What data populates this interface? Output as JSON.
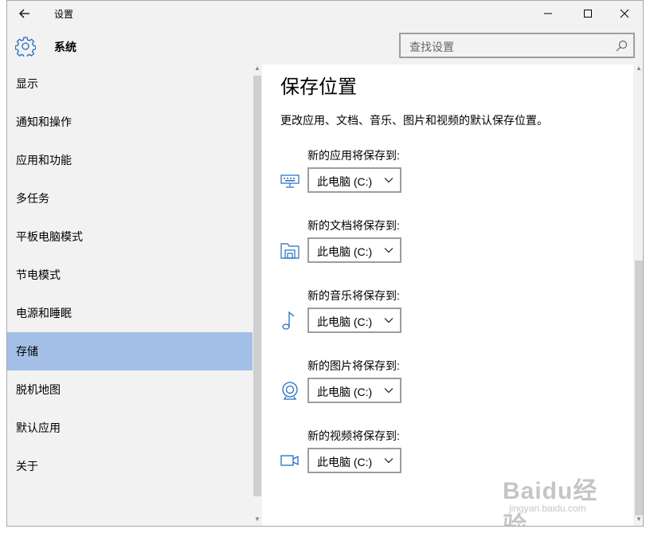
{
  "window": {
    "title": "设置",
    "section_title": "系统",
    "controls": {
      "minimize": "minimize-icon",
      "maximize": "maximize-icon",
      "close": "close-icon"
    }
  },
  "search": {
    "placeholder": "查找设置"
  },
  "sidebar": {
    "items": [
      {
        "label": "显示"
      },
      {
        "label": "通知和操作"
      },
      {
        "label": "应用和功能"
      },
      {
        "label": "多任务"
      },
      {
        "label": "平板电脑模式"
      },
      {
        "label": "节电模式"
      },
      {
        "label": "电源和睡眠"
      },
      {
        "label": "存储",
        "active": true
      },
      {
        "label": "脱机地图"
      },
      {
        "label": "默认应用"
      },
      {
        "label": "关于"
      }
    ]
  },
  "main": {
    "title": "保存位置",
    "description": "更改应用、文档、音乐、图片和视频的默认保存位置。",
    "groups": [
      {
        "label": "新的应用将保存到:",
        "value": "此电脑 (C:)",
        "icon": "monitor-icon"
      },
      {
        "label": "新的文档将保存到:",
        "value": "此电脑 (C:)",
        "icon": "folder-icon"
      },
      {
        "label": "新的音乐将保存到:",
        "value": "此电脑 (C:)",
        "icon": "music-note-icon"
      },
      {
        "label": "新的图片将保存到:",
        "value": "此电脑 (C:)",
        "icon": "camera-icon"
      },
      {
        "label": "新的视频将保存到:",
        "value": "此电脑 (C:)",
        "icon": "video-camera-icon"
      }
    ]
  },
  "watermark": {
    "logo": "Baidu经验",
    "url": "jingyan.baidu.com"
  },
  "colors": {
    "accent": "#1e6fc0",
    "active_nav": "#a3bfe5",
    "chrome": "#f2f2f2"
  }
}
